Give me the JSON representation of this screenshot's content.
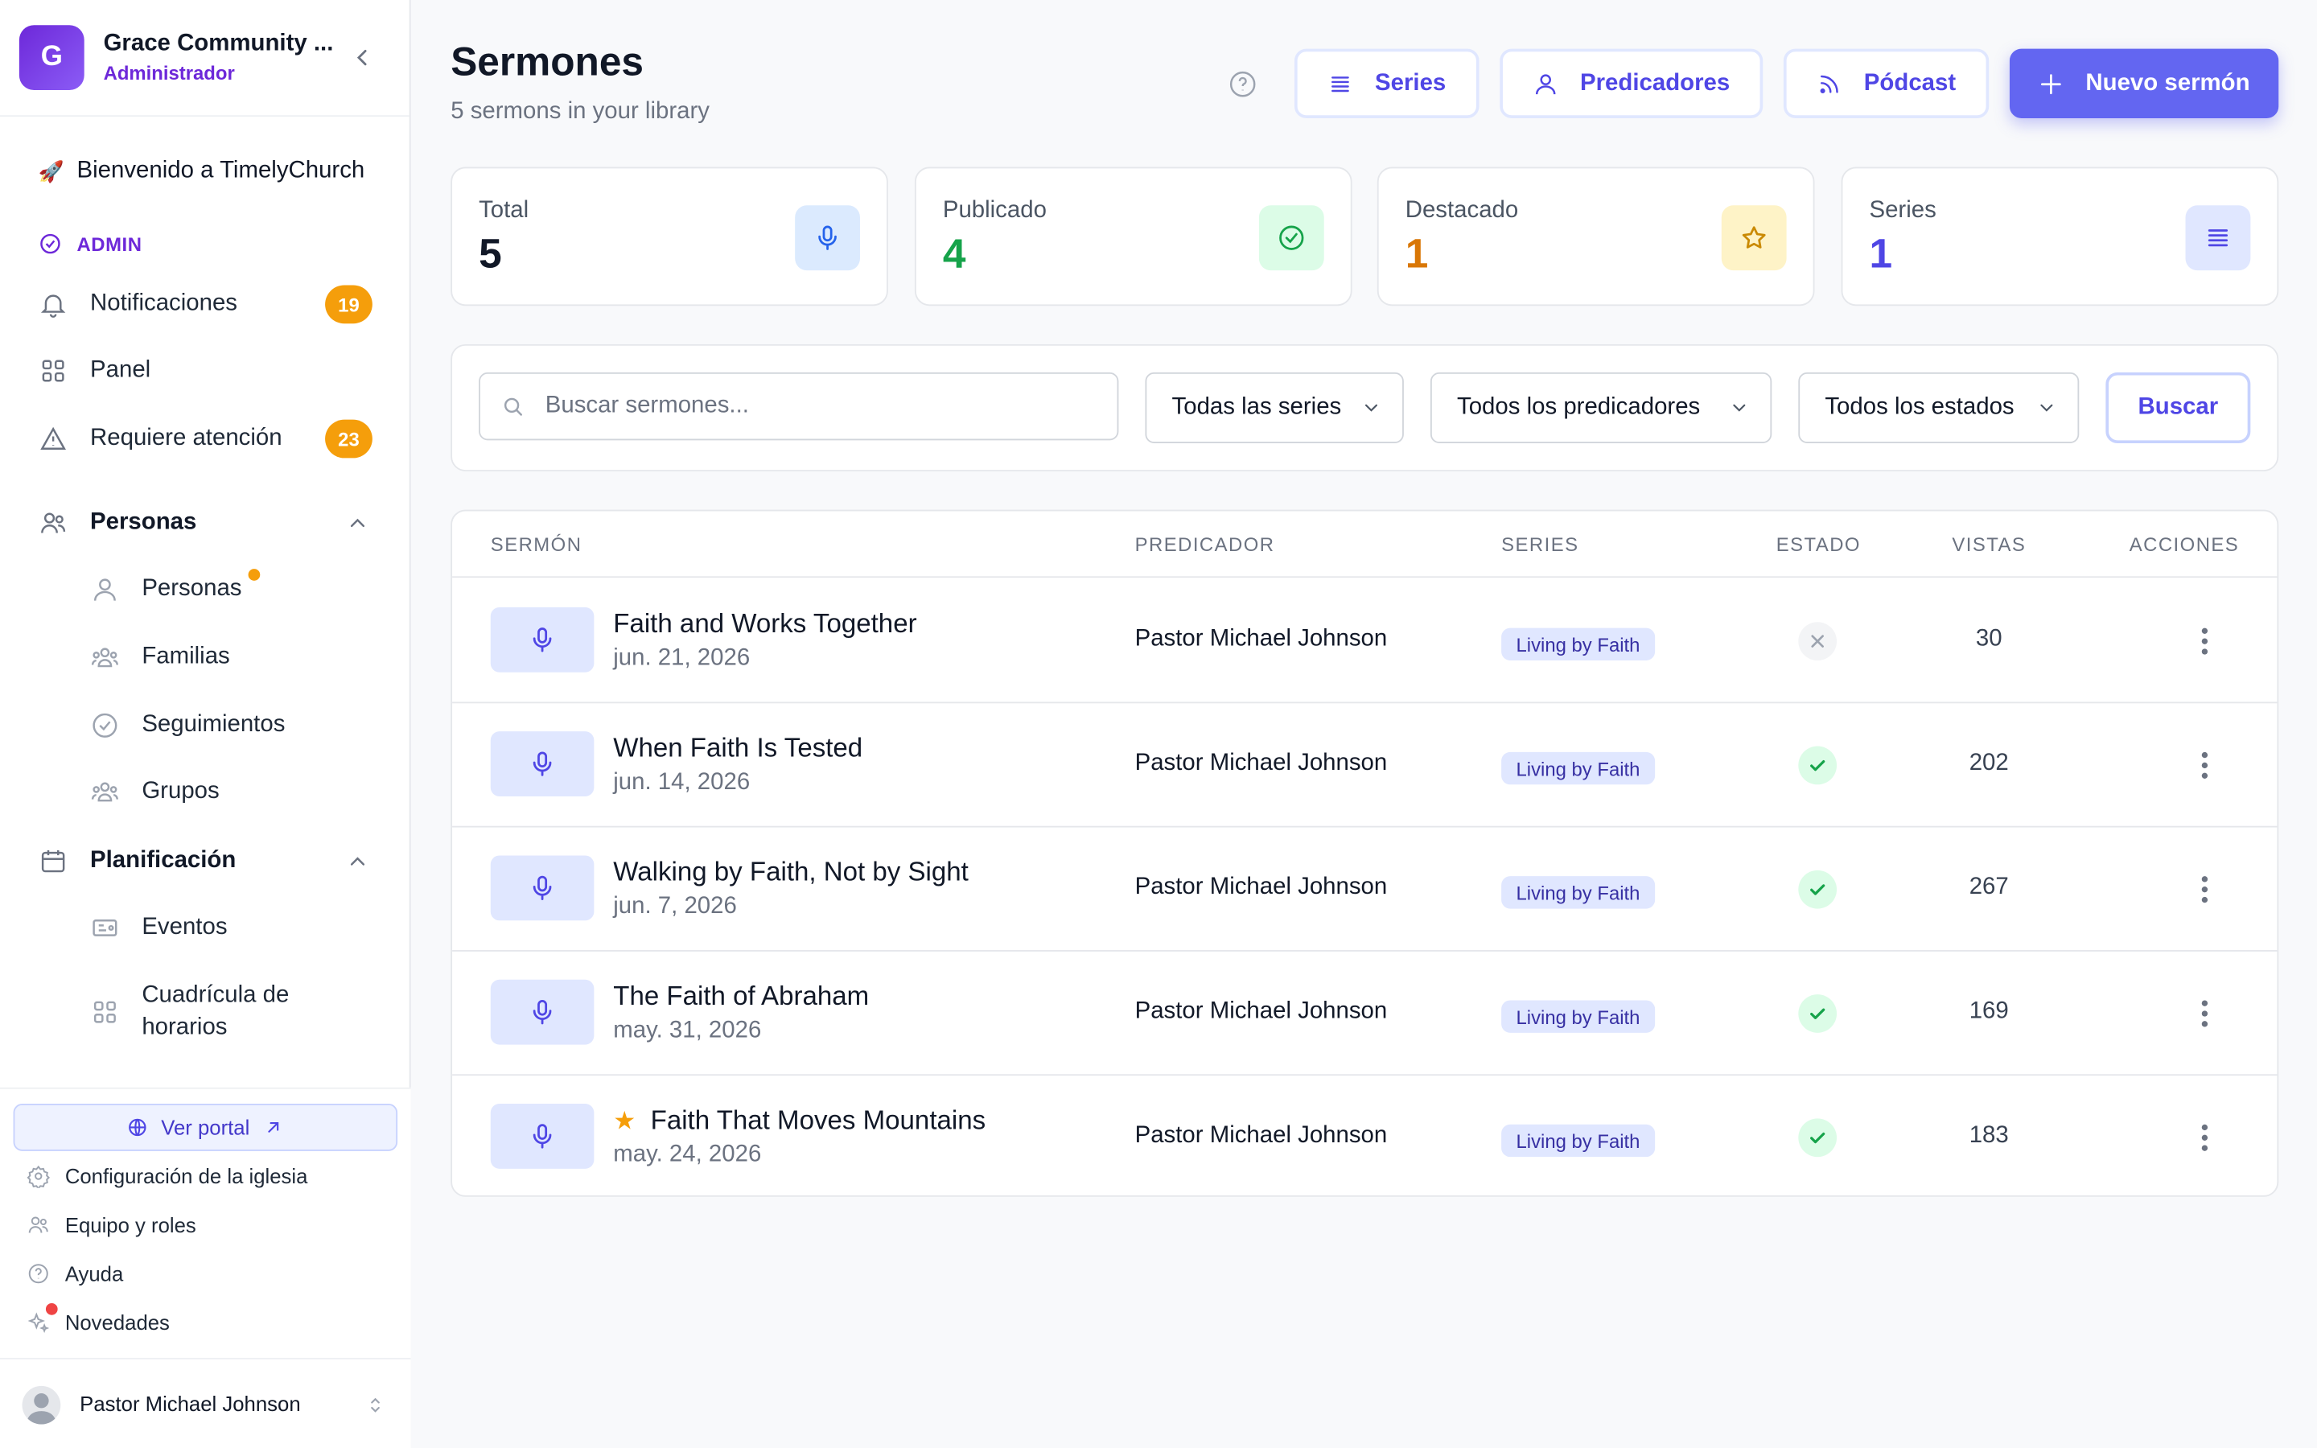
{
  "sidebar": {
    "logo_letter": "G",
    "church_name": "Grace Community ...",
    "role": "Administrador",
    "welcome": "Bienvenido a TimelyChurch",
    "section_admin": "ADMIN",
    "items": [
      {
        "label": "Notificaciones",
        "badge": "19"
      },
      {
        "label": "Panel"
      },
      {
        "label": "Requiere atención",
        "badge": "23"
      }
    ],
    "groups": [
      {
        "label": "Personas",
        "children": [
          "Personas",
          "Familias",
          "Seguimientos",
          "Grupos"
        ]
      },
      {
        "label": "Planificación",
        "children": [
          "Eventos",
          "Cuadrícula de horarios"
        ]
      }
    ],
    "portal_label": "Ver portal",
    "bottom_links": [
      "Configuración de la iglesia",
      "Equipo y roles",
      "Ayuda",
      "Novedades"
    ],
    "user_name": "Pastor Michael Johnson"
  },
  "header": {
    "title": "Sermones",
    "subtitle": "5 sermons in your library",
    "buttons": {
      "series": "Series",
      "preachers": "Predicadores",
      "podcast": "Pódcast",
      "new": "Nuevo sermón"
    }
  },
  "stats": [
    {
      "label": "Total",
      "value": "5",
      "color": "#111827"
    },
    {
      "label": "Publicado",
      "value": "4",
      "color": "#16a34a"
    },
    {
      "label": "Destacado",
      "value": "1",
      "color": "#d97706"
    },
    {
      "label": "Series",
      "value": "1",
      "color": "#4f46e5"
    }
  ],
  "filters": {
    "search_placeholder": "Buscar sermones...",
    "series": "Todas las series",
    "preachers": "Todos los predicadores",
    "status": "Todos los estados",
    "search_button": "Buscar"
  },
  "table": {
    "columns": [
      "SERMÓN",
      "PREDICADOR",
      "SERIES",
      "ESTADO",
      "VISTAS",
      "ACCIONES"
    ],
    "rows": [
      {
        "title": "Faith and Works Together",
        "date": "jun. 21, 2026",
        "preacher": "Pastor Michael Johnson",
        "series": "Living by Faith",
        "status": "unpublished",
        "views": "30",
        "featured": false
      },
      {
        "title": "When Faith Is Tested",
        "date": "jun. 14, 2026",
        "preacher": "Pastor Michael Johnson",
        "series": "Living by Faith",
        "status": "published",
        "views": "202",
        "featured": false
      },
      {
        "title": "Walking by Faith, Not by Sight",
        "date": "jun. 7, 2026",
        "preacher": "Pastor Michael Johnson",
        "series": "Living by Faith",
        "status": "published",
        "views": "267",
        "featured": false
      },
      {
        "title": "The Faith of Abraham",
        "date": "may. 31, 2026",
        "preacher": "Pastor Michael Johnson",
        "series": "Living by Faith",
        "status": "published",
        "views": "169",
        "featured": false
      },
      {
        "title": "Faith That Moves Mountains",
        "date": "may. 24, 2026",
        "preacher": "Pastor Michael Johnson",
        "series": "Living by Faith",
        "status": "published",
        "views": "183",
        "featured": true
      }
    ]
  }
}
